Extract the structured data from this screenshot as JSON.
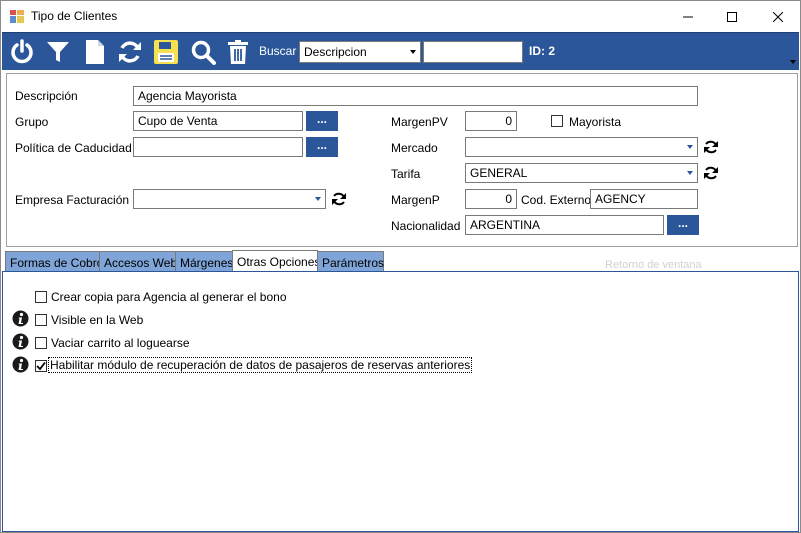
{
  "window": {
    "title": "Tipo de Clientes",
    "controls": [
      "minimize-icon",
      "maximize-icon",
      "close-icon"
    ]
  },
  "toolbar": {
    "icons": [
      "power-icon",
      "filter-icon",
      "new-document-icon",
      "refresh-icon",
      "save-icon",
      "search-icon",
      "delete-icon"
    ],
    "buscar_label": "Buscar",
    "buscar_combo_value": "Descripcion",
    "search_value": "",
    "id_label": "ID: 2"
  },
  "form": {
    "descripcion_label": "Descripción",
    "descripcion_value": "Agencia Mayorista",
    "grupo_label": "Grupo",
    "grupo_value": "Cupo de Venta",
    "politica_label": "Política de Caducidad",
    "politica_value": "",
    "empresa_label": "Empresa Facturación",
    "empresa_value": "",
    "margenpv_label": "MargenPV",
    "margenpv_value": "0",
    "mayorista_label": "Mayorista",
    "mayorista_checked": false,
    "mercado_label": "Mercado",
    "mercado_value": "",
    "tarifa_label": "Tarifa",
    "tarifa_value": "GENERAL",
    "margenp_label": "MargenP",
    "margenp_value": "0",
    "cod_externo_label": "Cod. Externo",
    "cod_externo_value": "AGENCY",
    "nacionalidad_label": "Nacionalidad",
    "nacionalidad_value": "ARGENTINA",
    "dots_label": "..."
  },
  "tabs": [
    {
      "label": "Formas de Cobro",
      "active": false
    },
    {
      "label": "Accesos Web",
      "active": false
    },
    {
      "label": "Márgenes",
      "active": false
    },
    {
      "label": "Otras Opciones",
      "active": true
    },
    {
      "label": "Parámetros",
      "active": false
    }
  ],
  "ghost_text": "Retorno de ventana",
  "options": [
    {
      "label": "Crear copia para Agencia al generar el bono",
      "checked": false,
      "info": false
    },
    {
      "label": "Visible en la Web",
      "checked": false,
      "info": true
    },
    {
      "label": "Vaciar carrito al loguearse",
      "checked": false,
      "info": true
    },
    {
      "label": "Habilitar módulo de recuperación de datos de pasajeros de reservas anteriores",
      "checked": true,
      "info": true
    }
  ],
  "colors": {
    "accent": "#2b579a",
    "tab_inactive": "#7ea4d8",
    "save_icon": "#f5e050"
  }
}
